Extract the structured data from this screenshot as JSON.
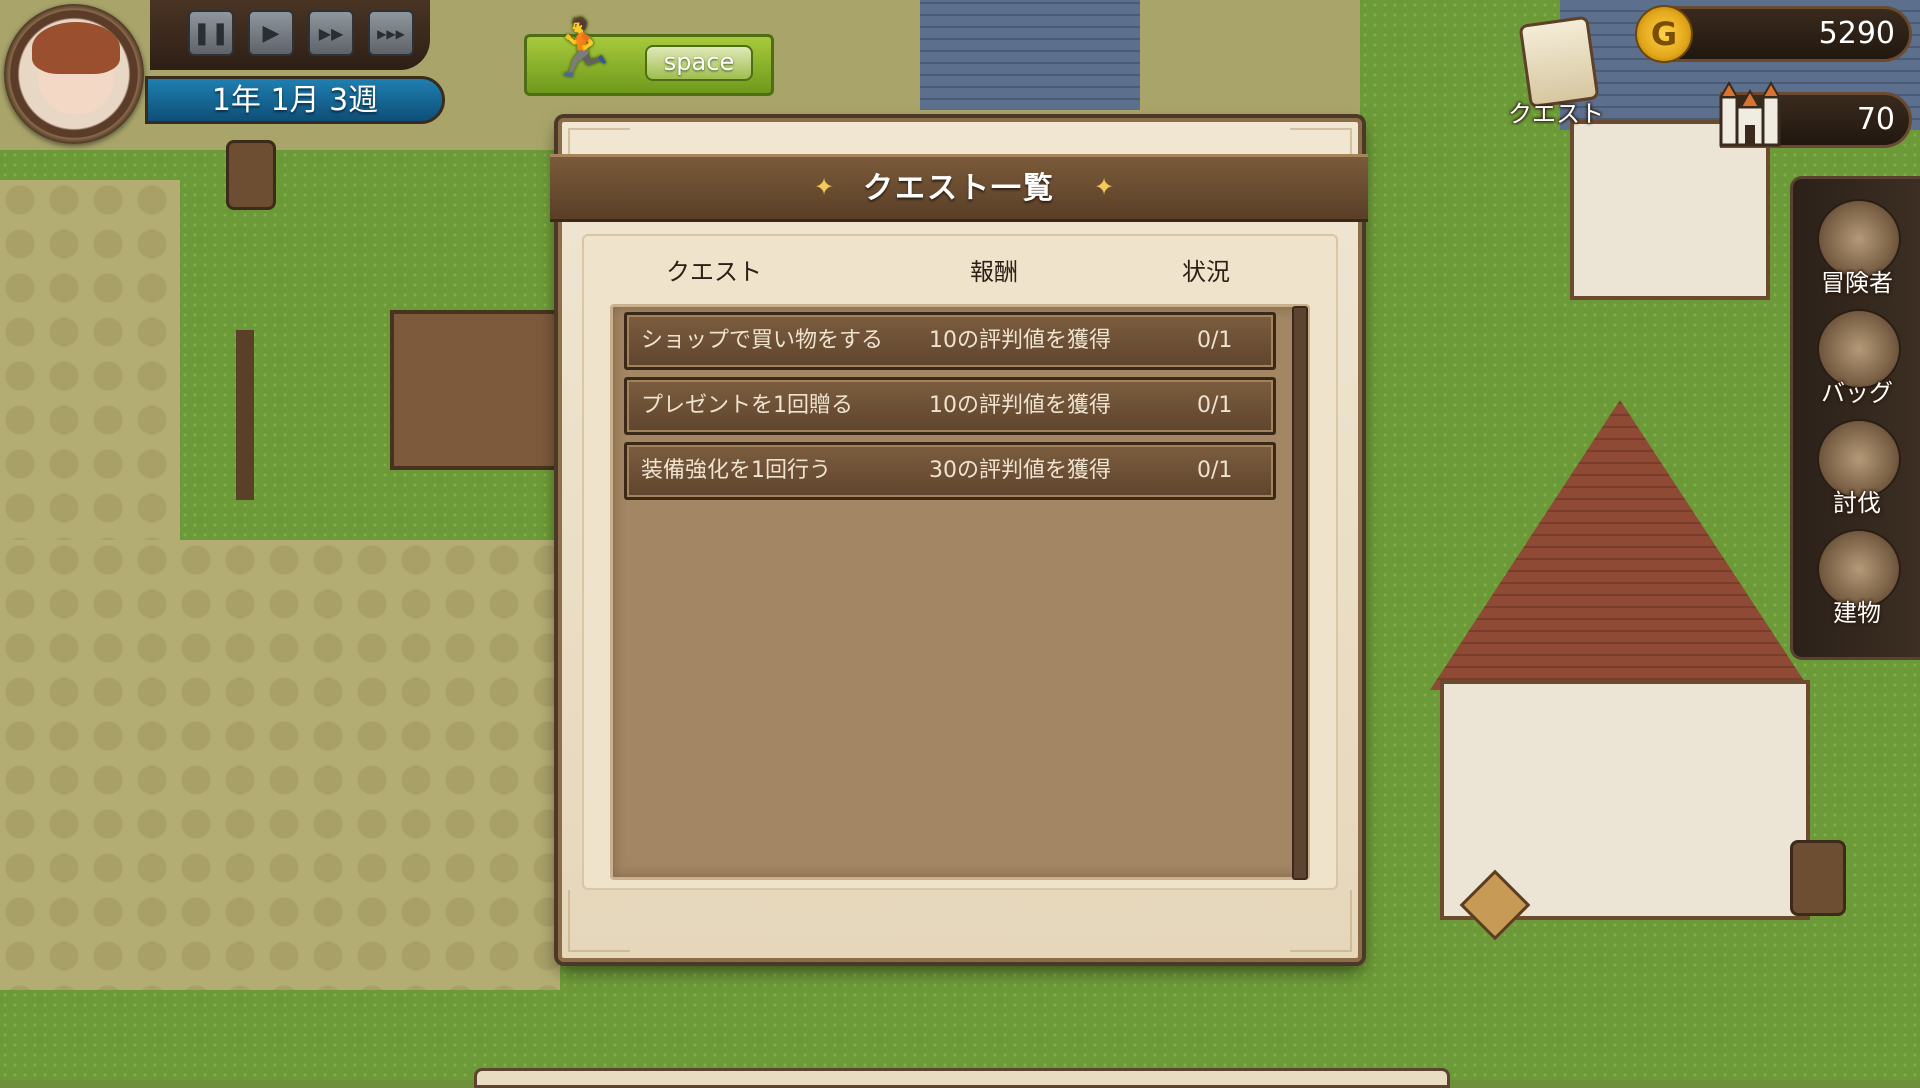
{
  "hud": {
    "date": "1年 1月 3週",
    "speed_key_label": "space",
    "media_controls": [
      {
        "name": "pause-button",
        "glyph": "❚❚"
      },
      {
        "name": "play-button",
        "glyph": "▶"
      },
      {
        "name": "fast-forward-button",
        "glyph": "▶▶"
      },
      {
        "name": "fastest-forward-button",
        "glyph": "▶▶▶"
      }
    ],
    "gold": "5290",
    "gold_coin_letter": "G",
    "reputation": "70",
    "quest_button_label": "クエスト"
  },
  "side_menu": [
    {
      "label": "冒険者",
      "icon": "adventurer-icon"
    },
    {
      "label": "バッグ",
      "icon": "bag-icon"
    },
    {
      "label": "討伐",
      "icon": "subjugation-icon"
    },
    {
      "label": "建物",
      "icon": "building-icon"
    }
  ],
  "dialog": {
    "title": "クエスト一覧",
    "columns": {
      "quest": "クエスト",
      "reward": "報酬",
      "status": "状況"
    },
    "rows": [
      {
        "quest": "ショップで買い物をする",
        "reward": "10の評判値を獲得",
        "status": "0/1"
      },
      {
        "quest": "プレゼントを1回贈る",
        "reward": "10の評判値を獲得",
        "status": "0/1"
      },
      {
        "quest": "装備強化を1回行う",
        "reward": "30の評判値を獲得",
        "status": "0/1"
      }
    ]
  },
  "colors": {
    "accent": "#6f9a1c",
    "date_plate": "#1f7fb0",
    "panel_brown": "#5f452d"
  }
}
